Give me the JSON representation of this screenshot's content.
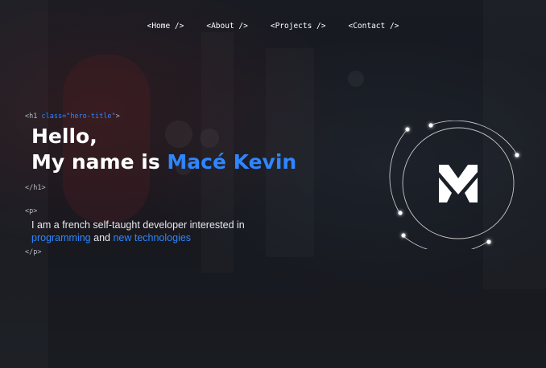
{
  "nav": {
    "items": [
      {
        "label": "<Home />"
      },
      {
        "label": "<About />"
      },
      {
        "label": "<Projects />"
      },
      {
        "label": "<Contact />"
      }
    ]
  },
  "hero": {
    "h1_open": {
      "tag": "<h1",
      "attr_name": "class=",
      "attr_value": "\"hero-title\"",
      "close": ">"
    },
    "title_line1": "Hello,",
    "title_line2_prefix": "My name is ",
    "title_name": "Macé Kevin",
    "h1_close": "</h1>",
    "p_open": "<p>",
    "text_line1": "I am a french self-taught developer interested in",
    "link1": "programming",
    "text_and": " and ",
    "link2": "new technologies",
    "p_close": "</p>"
  },
  "logo": {
    "icon": "m-logo-icon"
  },
  "colors": {
    "accent": "#2f86ff",
    "text": "#ffffff",
    "code": "#b9bcc6",
    "background": "#1b1d24"
  }
}
